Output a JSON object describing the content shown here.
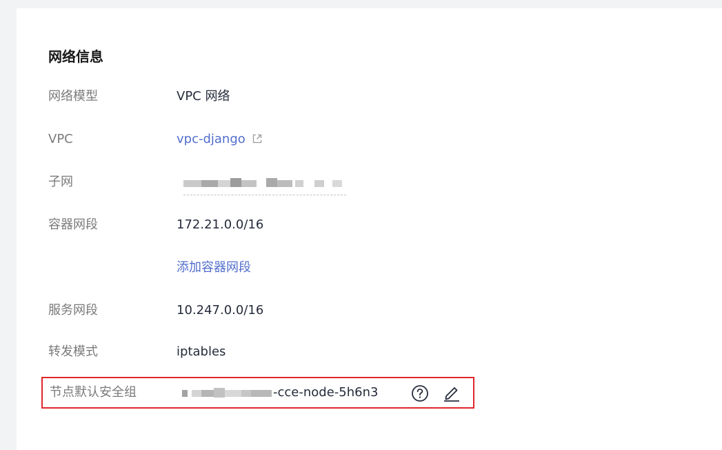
{
  "section": {
    "title": "网络信息"
  },
  "fields": {
    "network_model": {
      "label": "网络模型",
      "value": "VPC 网络"
    },
    "vpc": {
      "label": "VPC",
      "value": "vpc-django",
      "icon": "external-link-icon"
    },
    "subnet": {
      "label": "子网"
    },
    "container_cidr": {
      "label": "容器网段",
      "value": "172.21.0.0/16",
      "add_link": "添加容器网段"
    },
    "service_cidr": {
      "label": "服务网段",
      "value": "10.247.0.0/16"
    },
    "forward_mode": {
      "label": "转发模式",
      "value": "iptables"
    },
    "security_group": {
      "label": "节点默认安全组",
      "value_suffix": "-cce-node-5h6n3",
      "help_icon": "question-circle-icon",
      "edit_icon": "pencil-edit-icon"
    }
  },
  "colors": {
    "label": "#7a7a7a",
    "value": "#252b3a",
    "link": "#526ecc",
    "highlight_border": "#e0262b"
  }
}
